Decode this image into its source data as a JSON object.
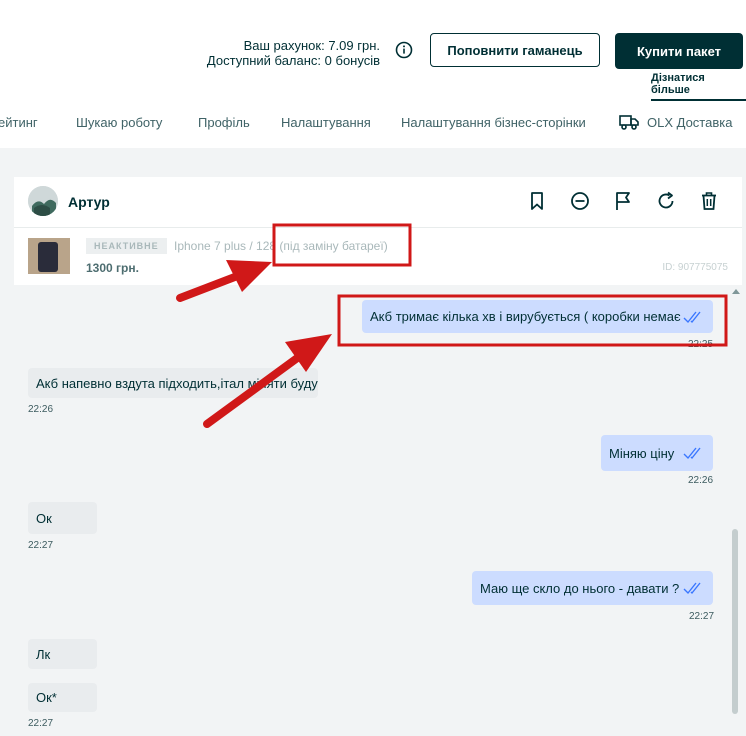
{
  "header": {
    "account_line": "Ваш рахунок: 7.09 грн.",
    "balance_line": "Доступний баланс: 0 бонусів",
    "topup_label": "Поповнити гаманець",
    "buy_label": "Купити пакет",
    "learn_more": "Дізнатися більше"
  },
  "nav": {
    "items": [
      "ейтинг",
      "Шукаю роботу",
      "Профіль",
      "Налаштування",
      "Налаштування бізнес-сторінки",
      "OLX Доставка"
    ]
  },
  "chat": {
    "user_name": "Артур",
    "ad": {
      "status": "НЕАКТИВНЕ",
      "title": "Iphone 7 plus / 128 (під заміну батареї)",
      "price": "1300 грн.",
      "id": "ID: 907775075"
    },
    "messages": [
      {
        "dir": "out",
        "text": "Акб тримає кілька хв і вирубується ( коробки немає",
        "time": "22:25"
      },
      {
        "dir": "in",
        "text": "Акб напевно вздута підходить,італ міняти буду",
        "time": "22:26"
      },
      {
        "dir": "out",
        "text": "Міняю ціну",
        "time": "22:26"
      },
      {
        "dir": "in",
        "text": "Ок",
        "time": "22:27"
      },
      {
        "dir": "out",
        "text": "Маю ще скло до нього - давати ?",
        "time": "22:27"
      },
      {
        "dir": "in",
        "text": "Лк",
        "time": ""
      },
      {
        "dir": "in",
        "text": "Ок*",
        "time": "22:27"
      }
    ]
  },
  "colors": {
    "brand_dark": "#002f34",
    "outgoing_bubble": "#ccdcff",
    "incoming_bubble": "#e9ecee",
    "read_tick": "#3a77ff",
    "annotation_red": "#d01818"
  }
}
